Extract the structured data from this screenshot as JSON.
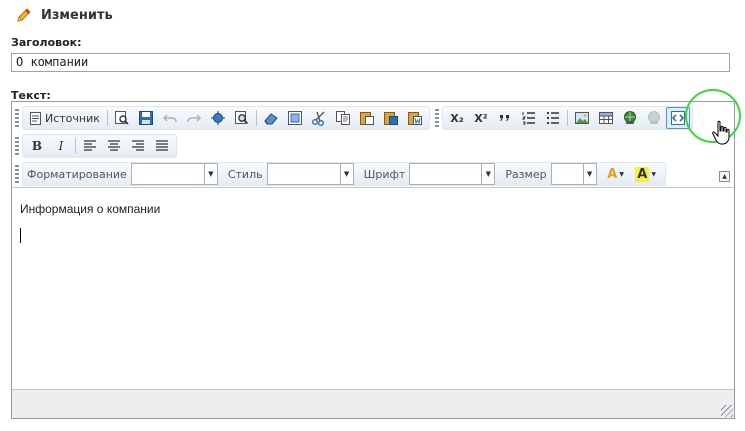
{
  "page": {
    "title": "Изменить",
    "icon": "pencil-icon"
  },
  "form": {
    "title_label": "Заголовок:",
    "title_value": "О компании",
    "text_label": "Текст:"
  },
  "toolbar": {
    "source_label": "Источник",
    "format_label": "Форматирование",
    "format_value": "",
    "style_label": "Стиль",
    "style_value": "",
    "font_label": "Шрифт",
    "font_value": "",
    "size_label": "Размер",
    "size_value": "",
    "subscript": "X₂",
    "superscript": "X²",
    "bold": "B",
    "italic": "I",
    "text_color": "A",
    "bg_color": "A"
  },
  "editor": {
    "content_line": "Информация о компании"
  },
  "colors": {
    "highlight_ring": "#3ed63e",
    "accent": "#1f62b5"
  }
}
